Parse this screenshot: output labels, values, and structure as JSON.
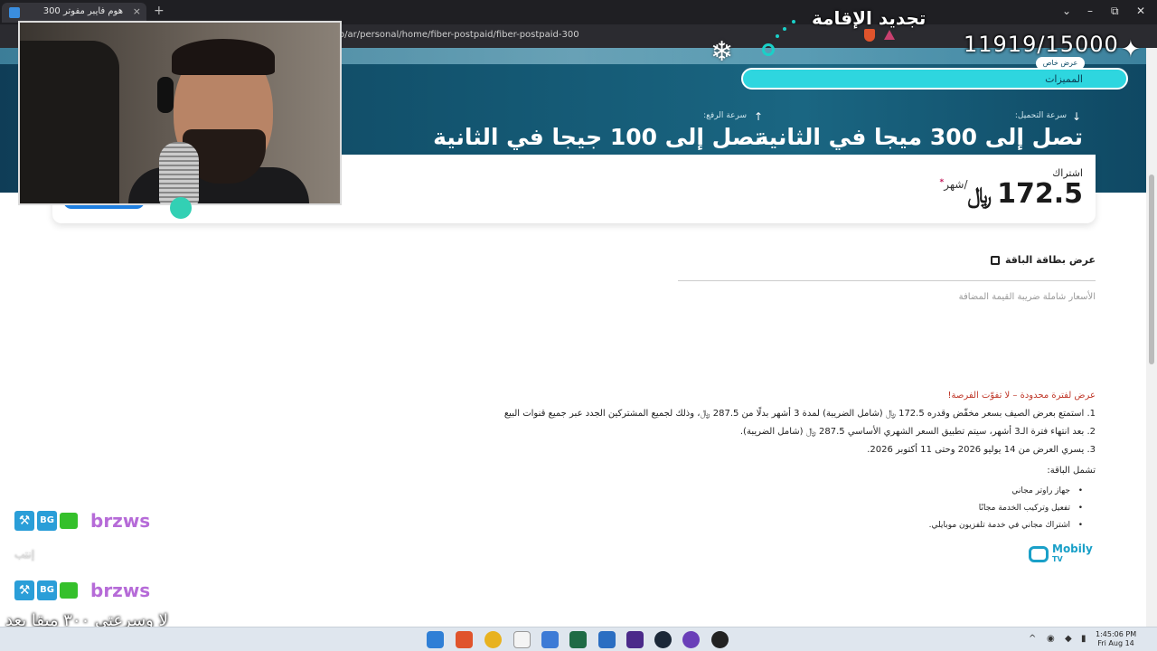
{
  "browser": {
    "tab_title": "هوم فايبر مفوتر 300",
    "tab_close": "×",
    "new_tab": "+",
    "url": "o/ar/personal/home/fiber-postpaid/fiber-postpaid-300",
    "window_buttons": [
      "⌄",
      "–",
      "⧉",
      "✕"
    ]
  },
  "hero": {
    "download_label": "سرعة التحميل:",
    "download_value": "تصل إلى 300 ميجا في الثانية",
    "upload_label": "سرعة الرفع:",
    "upload_value": "تصل إلى 100 جيجا في الثانية",
    "badge": "عرض خاص",
    "features_pill": "المميزات"
  },
  "price_card": {
    "subscription_label": "اشتراك",
    "price": "172.5",
    "currency": "﷼",
    "per": "/شهر",
    "star": "*"
  },
  "details": {
    "view_card": "عرض بطاقة الباقة",
    "vat_note": "الأسعار شاملة ضريبة القيمة المضافة",
    "offer_title": "عرض لفترة محدودة – لا تفوّت الفرصة!",
    "terms": [
      "1. استمتع بعرض الصيف بسعر مخفّض وقدره 172.5 ﷼ (شامل الضريبة) لمدة 3 أشهر بدلًا من 287.5 ﷼، وذلك لجميع المشتركين الجدد عبر جميع قنوات البيع",
      "2. بعد انتهاء فترة الـ3 أشهر، سيتم تطبيق السعر الشهري الأساسي 287.5 ﷼ (شامل الضريبة).",
      "3. يسري العرض من 14 يوليو 2026 وحتى 11 أكتوبر 2026."
    ],
    "includes_title": "تشمل الباقة:",
    "includes": [
      "جهاز راوتر مجاني",
      "تفعيل وتركيب الخدمة مجانًا",
      "اشتراك مجاني في خدمة تلفزيون موبايلي."
    ],
    "mobily_tv": "Mobily",
    "mobily_tv_sub": "TV"
  },
  "overlay": {
    "renew_title": "تجديد الإقامة",
    "counter": "11919/15000",
    "snowflake": "❄",
    "sparkle": "✦",
    "chat": [
      {
        "user": "brzws",
        "badge": "BG"
      },
      {
        "user": "brzws",
        "badge": "BG"
      }
    ],
    "chat_msg1": "إنتب",
    "chat_msg2": "لا وسرعتي ٣٠٠ ميقا بعد"
  },
  "taskbar": {
    "time": "1:45:06 PM",
    "date": "Fri Aug 14",
    "tray_up": "^"
  },
  "colors": {
    "hero_dark": "#0f3d57",
    "accent_teal": "#2ed6df",
    "offer_red": "#c0392b",
    "username_purple": "#b66bd8"
  }
}
